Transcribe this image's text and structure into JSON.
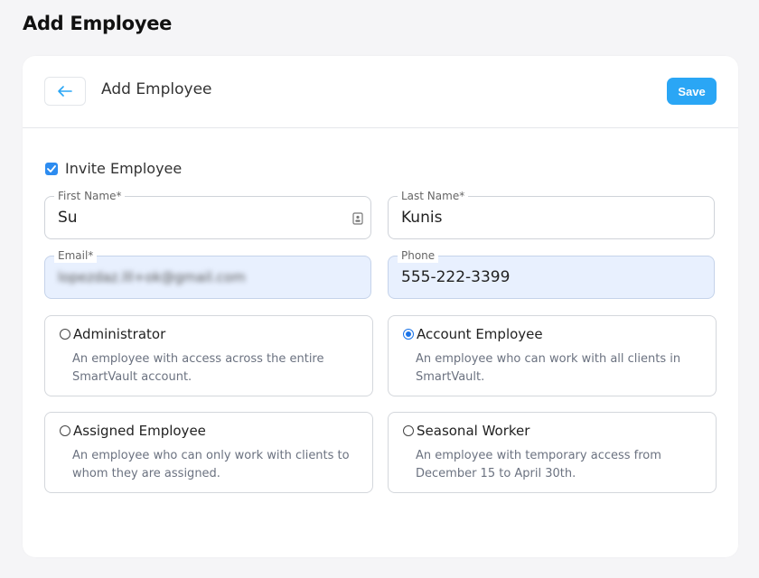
{
  "page": {
    "title": "Add Employee"
  },
  "header": {
    "title": "Add Employee",
    "back_icon": "arrow-left-icon",
    "save_label": "Save"
  },
  "invite": {
    "label": "Invite Employee",
    "checked": true
  },
  "fields": {
    "first_name": {
      "label": "First Name*",
      "value": "Su"
    },
    "last_name": {
      "label": "Last Name*",
      "value": "Kunis"
    },
    "email": {
      "label": "Email*",
      "value": "lopezdaz.lll+ok@gmail.com"
    },
    "phone": {
      "label": "Phone",
      "value": "555-222-3399"
    }
  },
  "roles": [
    {
      "title": "Administrator",
      "desc": "An employee with access across the entire SmartVault account.",
      "selected": false
    },
    {
      "title": "Account Employee",
      "desc": "An employee who can work with all clients in SmartVault.",
      "selected": true
    },
    {
      "title": "Assigned Employee",
      "desc": "An employee who can only work with clients to whom they are assigned.",
      "selected": false
    },
    {
      "title": "Seasonal Worker",
      "desc": "An employee with temporary access from December 15 to April 30th.",
      "selected": false
    }
  ],
  "colors": {
    "accent": "#2aa6f5",
    "radio_selected": "#1a73e8",
    "autofill_bg": "#e8f0fe"
  }
}
